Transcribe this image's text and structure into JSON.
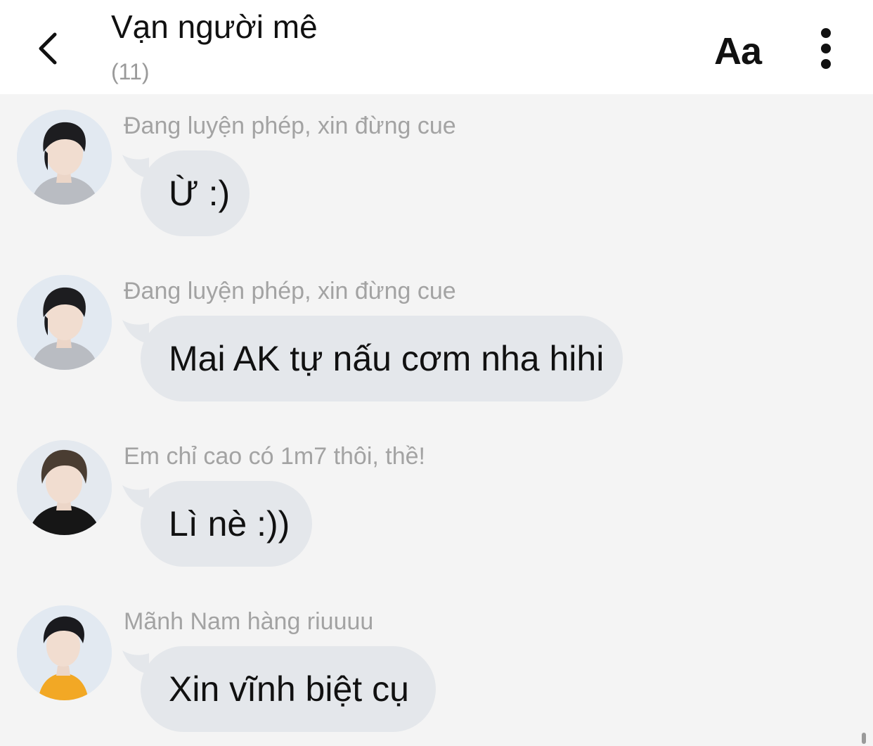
{
  "header": {
    "back_icon": "chevron-left-icon",
    "title": "Vạn người mê",
    "member_count": "(11)",
    "font_button_label": "Aa",
    "more_icon": "vertical-dots-icon"
  },
  "messages": [
    {
      "sender": "Đang luyện phép, xin đừng cue",
      "text": "Ừ :)",
      "avatar": "avatar-boy-gray-shirt"
    },
    {
      "sender": "Đang luyện phép, xin đừng cue",
      "text": "Mai AK tự nấu cơm nha hihi",
      "avatar": "avatar-boy-gray-shirt"
    },
    {
      "sender": "Em chỉ cao có 1m7 thôi, thề!",
      "text": "Lì nè :))",
      "avatar": "avatar-boy-black-shirt"
    },
    {
      "sender": "Mãnh Nam hàng riuuuu",
      "text": "Xin vĩnh biệt cụ",
      "avatar": "avatar-boy-yellow-shirt"
    }
  ],
  "colors": {
    "background": "#f4f4f4",
    "header_background": "#ffffff",
    "bubble": "#e4e7eb",
    "sender_text": "#a3a3a3"
  }
}
